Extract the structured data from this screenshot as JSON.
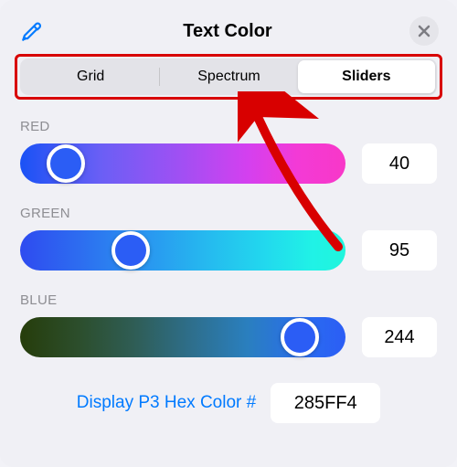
{
  "header": {
    "title": "Text Color"
  },
  "tabs": {
    "grid": "Grid",
    "spectrum": "Spectrum",
    "sliders": "Sliders",
    "active": "sliders"
  },
  "channels": {
    "red": {
      "label": "RED",
      "value": "40",
      "thumb_pct": 14
    },
    "green": {
      "label": "GREEN",
      "value": "95",
      "thumb_pct": 34
    },
    "blue": {
      "label": "BLUE",
      "value": "244",
      "thumb_pct": 86
    }
  },
  "hex": {
    "label": "Display P3 Hex Color #",
    "value": "285FF4"
  },
  "colors": {
    "accent": "#007aff",
    "thumb": "#2b5df5"
  }
}
